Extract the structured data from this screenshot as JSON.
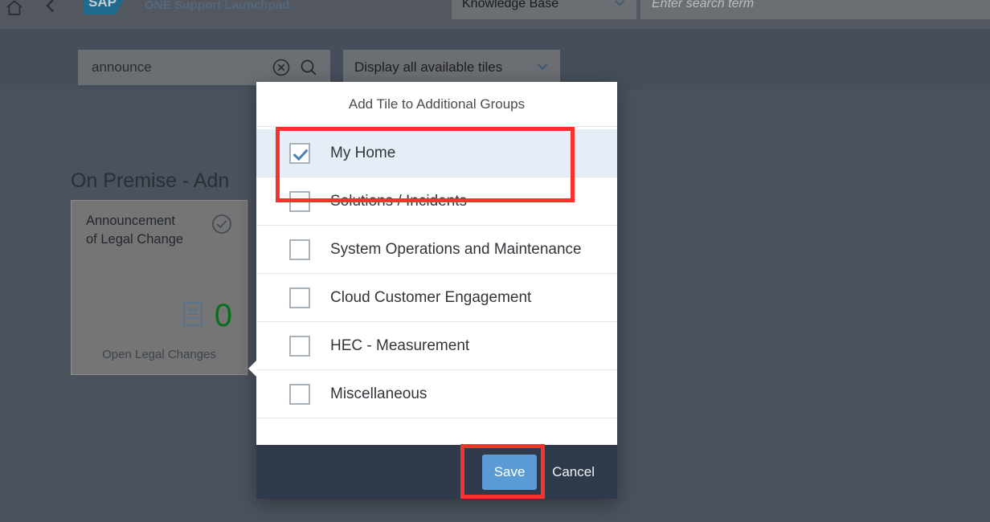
{
  "shell": {
    "product_title": "ONE Support Launchpad",
    "logo_text": "SAP",
    "home_icon": "home-icon",
    "back_icon": "chevron-left-icon",
    "scope_select": {
      "value": "Knowledge Base",
      "icon": "chevron-down-icon"
    },
    "global_search": {
      "value": "",
      "placeholder": "Enter search term"
    }
  },
  "toolbar": {
    "tile_search": {
      "value": "announce",
      "placeholder": "",
      "clear_icon": "clear-circle-icon",
      "search_icon": "search-icon"
    },
    "tiles_filter": {
      "value": "Display all available tiles",
      "icon": "chevron-down-icon"
    }
  },
  "catalog": {
    "group_title": "On Premise - Adn",
    "tile": {
      "name_line1": "Announcement",
      "name_line2": "of Legal Change",
      "status_icon": "check-circle-icon",
      "kpi_icon": "clipboard-icon",
      "kpi_value": "0",
      "kpi_label": "Open Legal Changes",
      "kpi_color": "#0a6e1e"
    }
  },
  "dialog": {
    "title": "Add Tile to Additional Groups",
    "groups": [
      {
        "label": "My Home",
        "checked": true,
        "selected": true
      },
      {
        "label": "Solutions / Incidents",
        "checked": false,
        "selected": false
      },
      {
        "label": "System Operations and Maintenance",
        "checked": false,
        "selected": false
      },
      {
        "label": "Cloud Customer Engagement",
        "checked": false,
        "selected": false
      },
      {
        "label": "HEC - Measurement",
        "checked": false,
        "selected": false
      },
      {
        "label": "Miscellaneous",
        "checked": false,
        "selected": false
      }
    ],
    "footer": {
      "save_label": "Save",
      "cancel_label": "Cancel",
      "save_color": "#5a9bd5",
      "bar_color": "#2f3a4a"
    }
  },
  "annotations": {
    "color": "#f8312c",
    "boxes": [
      {
        "target": "my-home-row"
      },
      {
        "target": "save-button"
      }
    ]
  }
}
